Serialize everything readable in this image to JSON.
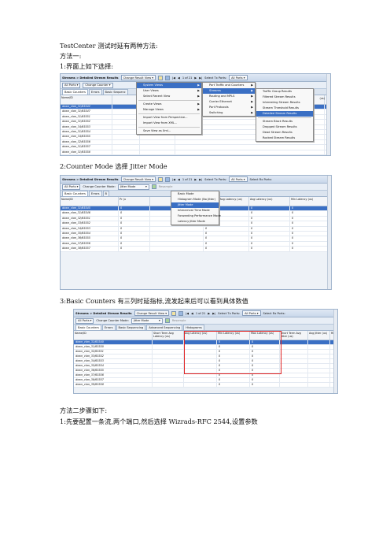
{
  "intro": {
    "title": "TestCenter 测试时延有两种方法:",
    "method1": "方法一:",
    "step1": "1:界面上如下选择:",
    "step2": "2:Counter Mode 选择 Jitter Mode",
    "step3": "3:Basic Counters 有三列时延指标,流发起来后可以看到具体数值",
    "method2": "方法二步骤如下:",
    "m2step1": "1:先要配置一条流,两个端口,然后选择 Wizrads-RFC 2544,设置参数"
  },
  "shot1": {
    "title": "Streams > Detailed Stream Results",
    "change_view": "Change Result View",
    "pager": "1 of 21",
    "select_tx": "Select Tx Ports:",
    "all_ports": "All Ports",
    "change_counter": "Change Counter",
    "tabs": [
      "Basic Counters",
      "Errors",
      "Basic Sequenc"
    ],
    "col_name": "Name/ID",
    "col_extra": "(us)",
    "rows": [
      "down_vlan_31/65542",
      "down_vlan_31/65547",
      "down_vlan_31/65551",
      "down_vlan_31/65552",
      "down_vlan_34/65553",
      "down_vlan_31/65554",
      "down_vlan_34/65555",
      "down_vlan_32/65556",
      "down_vlan_31/65557",
      "down_vlan_31/65558"
    ],
    "menu1": [
      "System Views",
      "User Views",
      "Select Recent View",
      "Create Views",
      "Manage Views",
      "Import View from Perspective...",
      "Import View from XML...",
      "Save View as Xml..."
    ],
    "menu2": [
      "Port Traffic and Counters",
      "Streams",
      "Routing and MPLS",
      "Carrier Ethernet",
      "Port Protocols",
      "Switching"
    ],
    "menu3": [
      "Traffic Group Results",
      "Filtered Stream Results",
      "Interesting Stream Results",
      "Stream Threshold Results",
      "Detailed Stream Results",
      "Stream Block Results",
      "Dropped Stream Results",
      "Dead Stream Results",
      "Rocked Stream Results"
    ]
  },
  "shot2": {
    "title": "Streams > Detailed Stream Results",
    "change_view": "Change Result View",
    "pager": "1 of 21",
    "select_tx": "Select Tx Ports:",
    "all_ports": "All Ports",
    "select_rx": "Select Rx Ports:",
    "change_mode": "Change Counter Mode:",
    "mode_value": "Jitter Mode",
    "resample": "Resample",
    "tabs": [
      "Basic Counters",
      "Errors",
      "B"
    ],
    "col_name": "Name/ID",
    "col_pre": "Pr (u",
    "col_fps": "(fps)",
    "col_short": "Short Term Avg Latency (us)",
    "col_avg": "Avg Latency (us)",
    "col_min": "Min Latency (us)",
    "modes": [
      "Basic Mode",
      "Histogram Mode (No Jitter)",
      "Jitter Mode",
      "Interarrival Time Mode",
      "Forwarding Performance Mode",
      "Latency Jitter Mode"
    ],
    "rows": [
      "down_vlan_31/65545",
      "down_vlan_31/65546",
      "down_vlan_32/65551",
      "down_vlan_33/65552",
      "down_vlan_34/65553",
      "down_vlan_35/65554",
      "down_vlan_36/65555",
      "down_vlan_37/65556",
      "down_vlan_38/65557"
    ],
    "zero": "0"
  },
  "shot3": {
    "title": "Streams > Detailed Stream Results",
    "change_view": "Change Result View",
    "pager": "1 of 21",
    "select_tx": "Select Tx Ports:",
    "all_ports": "All Ports",
    "select_rx": "Select Rx Ports:",
    "change_mode": "Change Counter Mode:",
    "mode_value": "Jitter Mode",
    "resample": "Resample",
    "tabs": [
      "Basic Counters",
      "Errors",
      "Basic Sequencing",
      "Advanced Sequencing",
      "Histograms"
    ],
    "col_name": "Name/ID",
    "col_short": "Short Term Avg Latency (us)",
    "col_avg": "Avg Latency (us)",
    "col_min": "Min Latency (us)",
    "col_max": "Max Latency (us)",
    "col_sjit": "Short Term Avg Jitter (us)",
    "col_ajit": "Avg Jitter (us)",
    "col_rfc": "RFC",
    "rows": [
      "down_vlan_31/65540",
      "down_vlan_31/65550",
      "down_vlan_32/65551",
      "down_vlan_33/65552",
      "down_vlan_34/65553",
      "down_vlan_35/65554",
      "down_vlan_36/65555",
      "down_vlan_37/65556",
      "down_vlan_38/65557",
      "down_vlan_39/65558"
    ],
    "zero": "0"
  },
  "colors": {
    "highlight": "#3a6fc4",
    "redbox": "#e02020"
  }
}
